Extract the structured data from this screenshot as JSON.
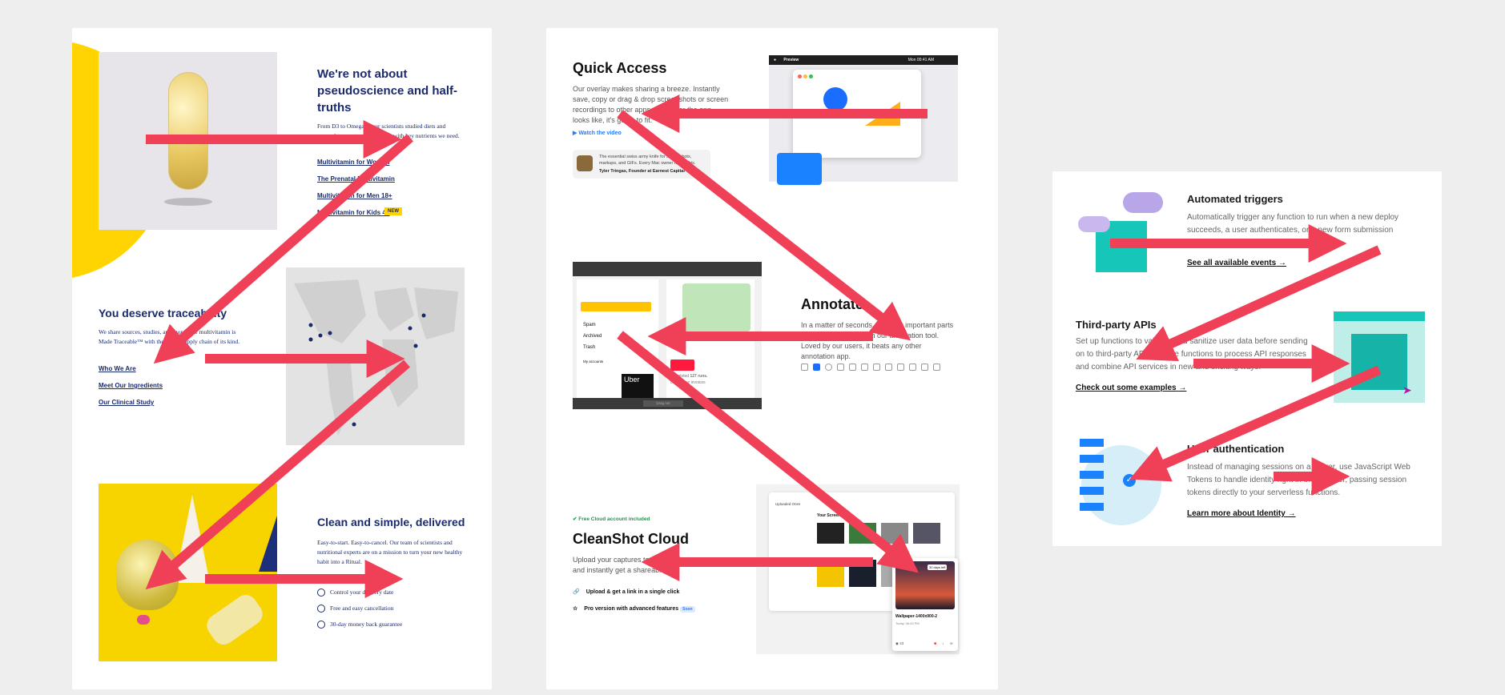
{
  "left": {
    "title": "We're not about pseudoscience and half-truths",
    "intro": "From D3 to Omega-3, our scientists studied diets and research to create multivitamin with key nutrients we need.",
    "links": [
      "Multivitamin for Women",
      "The Prenatal Multivitamin",
      "Multivitamin for Men 18+",
      "Multivitamin for Kids 4+"
    ],
    "new_badge": "NEW",
    "trace_title": "You deserve traceability",
    "trace_text": "We share sources, studies, and more. Our multivitamin is Made Traceable™ with the whole supply chain of its kind.",
    "trace_links": [
      "Who We Are",
      "Meet Our Ingredients",
      "Our Clinical Study"
    ],
    "clean_title": "Clean and simple, delivered",
    "clean_text": "Easy-to-start. Easy-to-cancel. Our team of scientists and nutritional experts are on a mission to turn your new healthy habit into a Ritual.",
    "features": [
      "Control your delivery date",
      "Free and easy cancellation",
      "30-day money back guarantee"
    ]
  },
  "middle": {
    "qa_title": "Quick Access",
    "qa_text": "Our overlay makes sharing a breeze. Instantly save, copy or drag & drop screenshots or screen recordings to other apps. Whatever the app looks like, it's going to fit.",
    "watch_link": "Watch the video",
    "quote": "The essential swiss army knife for screenshots, markups, and GIFs. Every Mac owner needs this.",
    "quote_author": "Tyler Tringas, Founder at Earnest Capital",
    "menubar_app": "Preview",
    "menubar_time": "Mon 00:41 AM",
    "annot_title": "Annotate",
    "annot_text": "In a matter of seconds, highlight important parts of your screenshot with our annotation tool. Loved by our users, it beats any other annotation app.",
    "annot_mock": {
      "menu": [
        "Spam",
        "Archived",
        "Trash"
      ],
      "accounts": "My accounts",
      "uber": "Uber",
      "completed_prefix": "completed",
      "completed_count": "127 runs.",
      "check_invoice": "check your invoices",
      "drag_me": "Drag me"
    },
    "cloud_badge": "Free Cloud account included",
    "cloud_title": "CleanShot Cloud",
    "cloud_text": "Upload your captures to the cloud and instantly get a shareable link.",
    "cloud_features": [
      "Upload & get a link in a single click",
      "Pro version with advanced features"
    ],
    "soon_badge": "Soon",
    "cloud_mock": {
      "sidebar_title": "Uploaded Ones",
      "grid_title": "Your Screenshot",
      "days_left": "30 days left",
      "file_name": "Wallpaper-1400x900-2",
      "file_time": "Today, 06:43 PM",
      "views": "43"
    }
  },
  "right": {
    "items": [
      {
        "title": "Automated triggers",
        "text": "Automatically trigger any function to run when a new deploy succeeds, a user authenticates, or a new form submission",
        "link": "See all available events"
      },
      {
        "title": "Third-party APIs",
        "text": "Set up functions to validate and sanitize user data before sending on to third-party APIs. Or use functions to process API responses and combine API services in new and exciting ways.",
        "link": "Check out some examples"
      },
      {
        "title": "User authentication",
        "text": "Instead of managing sessions on a server, use JavaScript Web Tokens to handle identity right in the browser, passing session tokens directly to your serverless functions.",
        "link": "Learn more about Identity"
      }
    ],
    "arrow_glyph": "→"
  },
  "colors": {
    "arrow": "#ef4058",
    "navy": "#1a2b6d",
    "yellow": "#ffd400",
    "teal": "#16c7b9",
    "blue": "#1a82ff"
  }
}
